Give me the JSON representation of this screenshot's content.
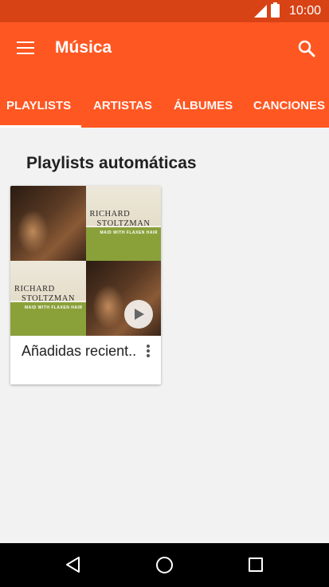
{
  "status_bar": {
    "time": "10:00"
  },
  "app_bar": {
    "title": "Música"
  },
  "tabs": [
    {
      "label": "PLAYLISTS",
      "selected": true
    },
    {
      "label": "ARTISTAS",
      "selected": false
    },
    {
      "label": "ÁLBUMES",
      "selected": false
    },
    {
      "label": "CANCIONES",
      "selected": false
    }
  ],
  "section": {
    "title": "Playlists automáticas"
  },
  "playlist_card": {
    "title": "Añadidas recient..",
    "album_art_text": {
      "artist_line1": "RICHARD",
      "artist_line2": "STOLTZMAN",
      "subtitle": "MAID WITH FLAXEN HAIR"
    }
  },
  "colors": {
    "accent": "#ff5722",
    "status_bar": "#d84315",
    "background": "#f2f2f2"
  },
  "icons": [
    "menu-icon",
    "search-icon",
    "play-icon",
    "overflow-icon",
    "back-icon",
    "home-icon",
    "recents-icon"
  ]
}
